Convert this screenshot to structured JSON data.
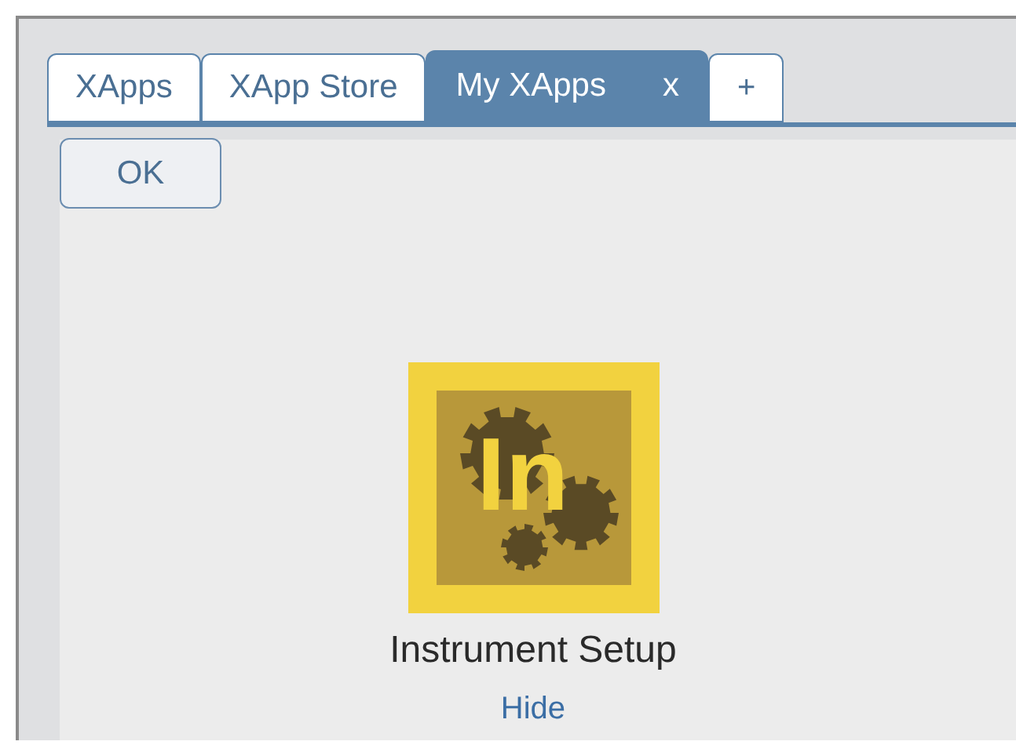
{
  "tabs": [
    {
      "label": "XApps",
      "selected": false
    },
    {
      "label": "XApp Store",
      "selected": false
    },
    {
      "label": "My XApps",
      "selected": true,
      "close_label": "x"
    }
  ],
  "add_tab": "+",
  "ok_button": "OK",
  "apps": [
    {
      "logo_text": "In",
      "name": "Instrument Setup",
      "hide_label": "Hide"
    }
  ]
}
